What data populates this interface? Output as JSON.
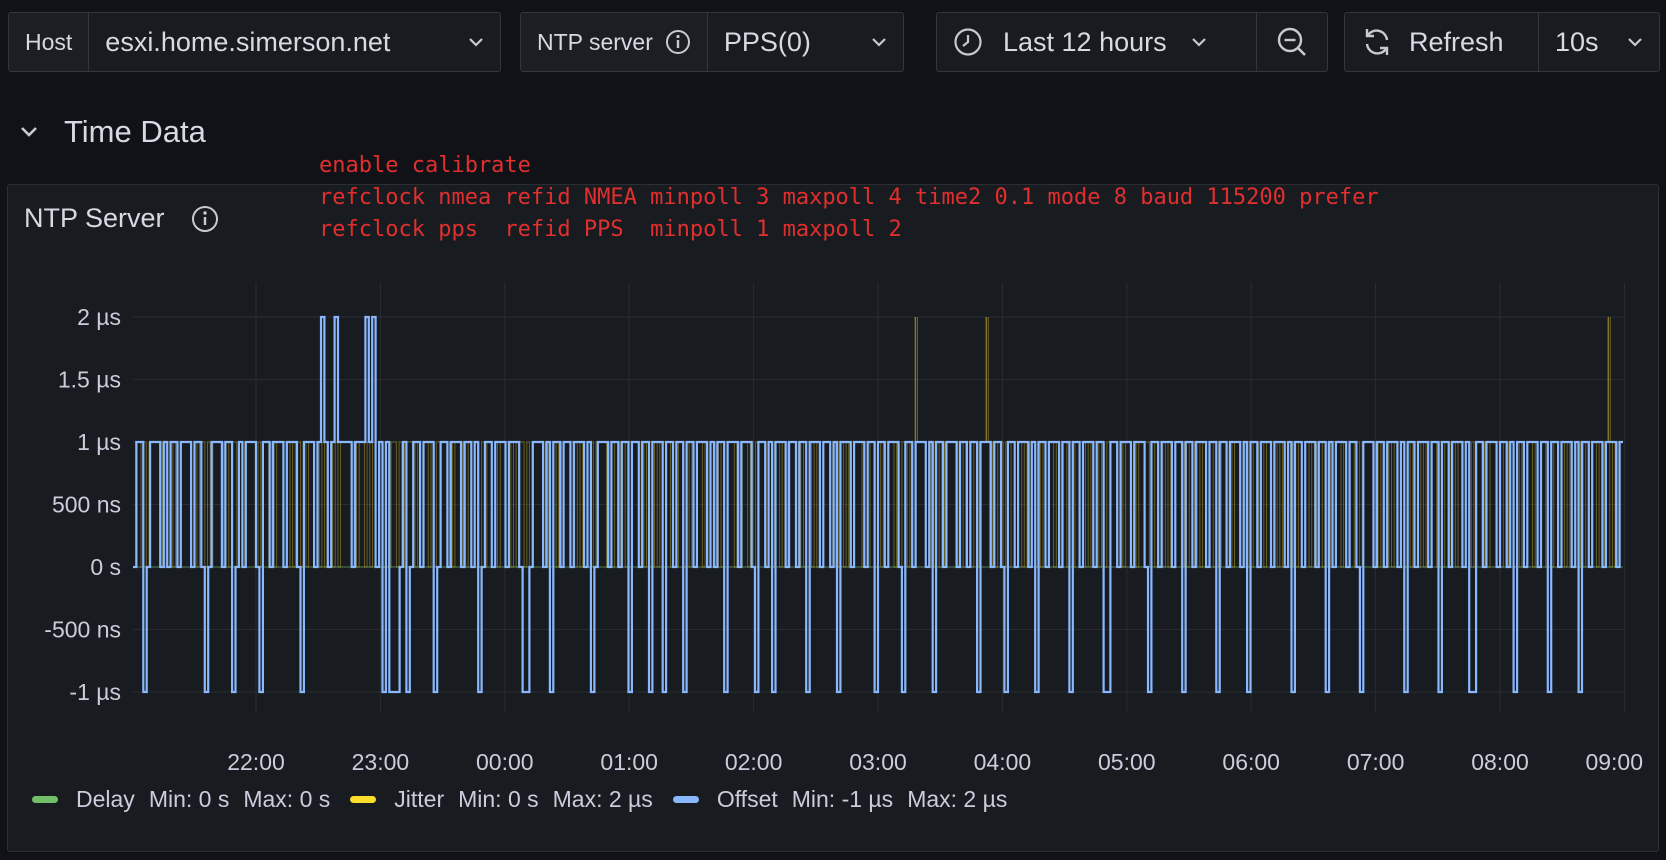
{
  "variables": {
    "host": {
      "label": "Host",
      "value": "esxi.home.simerson.net"
    },
    "ntp_server": {
      "label": "NTP server",
      "value": "PPS(0)"
    }
  },
  "time_picker": {
    "range": "Last 12 hours"
  },
  "refresh": {
    "label": "Refresh",
    "interval": "10s"
  },
  "row": {
    "title": "Time Data"
  },
  "panel": {
    "title": "NTP Server",
    "note_lines": [
      "enable calibrate",
      "refclock nmea refid NMEA minpoll 3 maxpoll 4 time2 0.1 mode 8 baud 115200 prefer",
      "refclock pps  refid PPS  minpoll 1 maxpoll 2"
    ]
  },
  "colors": {
    "delay": "#73bf69",
    "jitter": "#fade2a",
    "offset": "#8ab8ff"
  },
  "chart_data": {
    "type": "line",
    "y_ticks": [
      "2 µs",
      "1.5 µs",
      "1 µs",
      "500 ns",
      "0 s",
      "-500 ns",
      "-1 µs"
    ],
    "x_ticks": [
      "22:00",
      "23:00",
      "00:00",
      "01:00",
      "02:00",
      "03:00",
      "04:00",
      "05:00",
      "06:00",
      "07:00",
      "08:00",
      "09:00"
    ],
    "ylim_us": [
      -1,
      2
    ],
    "unit": "µs",
    "grid": true,
    "legend_position": "bottom-left",
    "series": [
      {
        "name": "Delay",
        "min": "0 s",
        "max": "0 s"
      },
      {
        "name": "Jitter",
        "min": "0 s",
        "max": "2 µs"
      },
      {
        "name": "Offset",
        "min": "-1 µs",
        "max": "2 µs"
      }
    ],
    "x_ticks_hours": [
      22,
      23,
      24,
      25,
      26,
      27,
      28,
      29,
      30,
      31,
      32,
      33
    ],
    "jitter_spikes_hours": [
      27.3,
      27.87,
      32.87
    ],
    "offset_spikes_hours": [
      22.53,
      22.89
    ],
    "offset_us": [
      0,
      1,
      1,
      -1,
      0,
      1,
      1,
      1,
      0,
      1,
      0,
      1,
      1,
      0,
      1,
      1,
      1,
      0,
      1,
      1,
      0,
      -1,
      0,
      1,
      1,
      1,
      0,
      1,
      1,
      -1,
      0,
      1,
      0,
      1,
      1,
      1,
      0,
      -1,
      1,
      1,
      0,
      1,
      1,
      1,
      0,
      1,
      1,
      1,
      0,
      -1,
      1,
      1,
      1,
      0,
      1,
      1,
      1,
      0,
      1,
      2,
      1,
      1,
      1,
      1,
      0,
      1,
      1,
      1,
      0,
      1,
      2,
      0,
      1,
      -1,
      1,
      -1,
      -1,
      -1,
      0,
      1,
      -1,
      0,
      1,
      1,
      0,
      1,
      1,
      1,
      -1,
      0,
      1,
      1,
      0,
      1,
      1,
      1,
      0,
      1,
      1,
      0,
      1,
      -1,
      0,
      1,
      1,
      0,
      1,
      1,
      1,
      0,
      1,
      1,
      1,
      0,
      -1,
      -1,
      0,
      1,
      1,
      1,
      0,
      1,
      -1,
      1,
      1,
      0,
      1,
      1,
      0,
      1,
      1,
      1,
      0,
      1,
      -1,
      0,
      1,
      1,
      1,
      0,
      1,
      1,
      0,
      1,
      1,
      -1,
      1,
      1,
      0,
      1,
      1,
      -1,
      1,
      1,
      1,
      -1,
      1,
      1,
      0,
      1,
      1,
      -1,
      1,
      1,
      0,
      1,
      1,
      1,
      0,
      1,
      0,
      1,
      1,
      -1,
      1,
      1,
      1,
      0,
      1,
      1,
      1,
      0,
      -1,
      1,
      1,
      0,
      1,
      -1,
      1,
      1,
      1,
      0,
      1,
      1,
      0,
      1,
      1,
      -1,
      1,
      1,
      1,
      0,
      1,
      1,
      0,
      1,
      -1,
      1,
      1,
      1,
      0,
      1,
      1,
      1,
      0,
      1,
      1,
      -1,
      1,
      1,
      0,
      1,
      1,
      1,
      0,
      -1,
      1,
      1,
      0,
      1,
      1,
      1,
      0,
      1,
      -1,
      1,
      1,
      0,
      1,
      1,
      1,
      0,
      1,
      1,
      0,
      1,
      1,
      -1,
      1,
      1,
      1,
      0,
      1,
      1,
      0,
      -1,
      1,
      1,
      0,
      1,
      1,
      1,
      0,
      1,
      -1,
      1,
      1,
      0,
      1,
      1,
      1,
      0,
      1,
      1,
      -1,
      1,
      1,
      0,
      1,
      1,
      1,
      0,
      1,
      1,
      -1,
      -1,
      1,
      1,
      0,
      1,
      1,
      1,
      0,
      1,
      1,
      1,
      0,
      -1,
      1,
      1,
      0,
      1,
      1,
      1,
      0,
      1,
      1,
      -1,
      1,
      1,
      0,
      1,
      1,
      1,
      0,
      1,
      1,
      -1,
      1,
      1,
      0,
      1,
      1,
      1,
      0,
      1,
      -1,
      1,
      1,
      0,
      1,
      1,
      1,
      0,
      1,
      1,
      1,
      0,
      1,
      -1,
      1,
      1,
      0,
      1,
      1,
      1,
      0,
      1,
      1,
      -1,
      1,
      0,
      1,
      1,
      1,
      0,
      1,
      1,
      0,
      -1,
      1,
      1,
      1,
      0,
      1,
      1,
      0,
      1,
      1,
      1,
      0,
      1,
      -1,
      1,
      1,
      0,
      1,
      1,
      1,
      0,
      1,
      1,
      -1,
      1,
      1,
      0,
      1,
      1,
      1,
      0,
      1,
      -1,
      -1,
      1,
      1,
      0,
      1,
      1,
      1,
      0,
      1,
      1,
      0,
      1,
      -1,
      1,
      1,
      0,
      1,
      1,
      1,
      0,
      1,
      1,
      -1,
      1,
      1,
      0,
      1,
      1,
      1,
      0,
      1,
      -1,
      1,
      1,
      0,
      1,
      1,
      1,
      0,
      1,
      1,
      1,
      0,
      1
    ]
  }
}
